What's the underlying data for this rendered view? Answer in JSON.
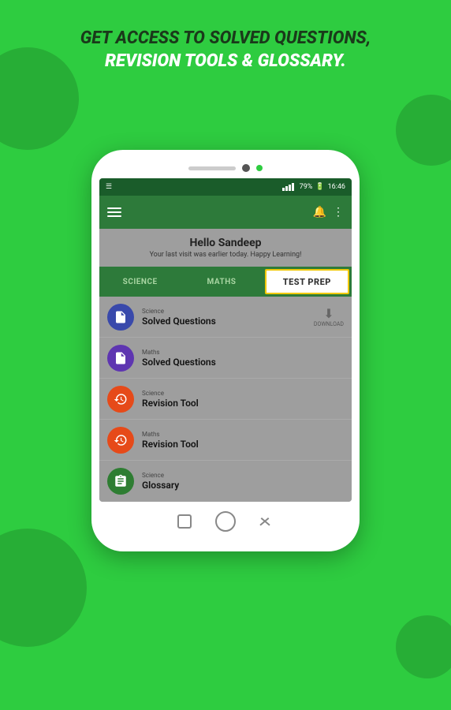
{
  "background": {
    "color": "#2ecc40"
  },
  "header": {
    "line1": "GET ACCESS TO SOLVED QUESTIONS,",
    "line2": "REVISION TOOLS & GLOSSARY."
  },
  "statusBar": {
    "signal": "signal",
    "battery": "79%",
    "time": "16:46"
  },
  "appBar": {
    "bell_label": "bell",
    "more_label": "more"
  },
  "greeting": {
    "name": "Hello Sandeep",
    "subtitle": "Your last visit was earlier today. Happy Learning!"
  },
  "tabs": [
    {
      "id": "science",
      "label": "SCIENCE",
      "active": false
    },
    {
      "id": "maths",
      "label": "MATHS",
      "active": false
    },
    {
      "id": "testprep",
      "label": "TEST PREP",
      "active": true
    }
  ],
  "listItems": [
    {
      "id": "item1",
      "category": "Science",
      "title": "Solved Questions",
      "iconColor": "blue",
      "iconType": "document",
      "hasDownload": true,
      "downloadLabel": "DOWNLOAD"
    },
    {
      "id": "item2",
      "category": "Maths",
      "title": "Solved Questions",
      "iconColor": "purple",
      "iconType": "document",
      "hasDownload": false
    },
    {
      "id": "item3",
      "category": "Science",
      "title": "Revision Tool",
      "iconColor": "orange",
      "iconType": "history",
      "hasDownload": false
    },
    {
      "id": "item4",
      "category": "Maths",
      "title": "Revision Tool",
      "iconColor": "orange",
      "iconType": "history",
      "hasDownload": false
    },
    {
      "id": "item5",
      "category": "Science",
      "title": "Glossary",
      "iconColor": "dark-green",
      "iconType": "clipboard",
      "hasDownload": false
    }
  ],
  "phoneBottom": {
    "square": "recent-apps",
    "circle": "home",
    "back": "back"
  }
}
